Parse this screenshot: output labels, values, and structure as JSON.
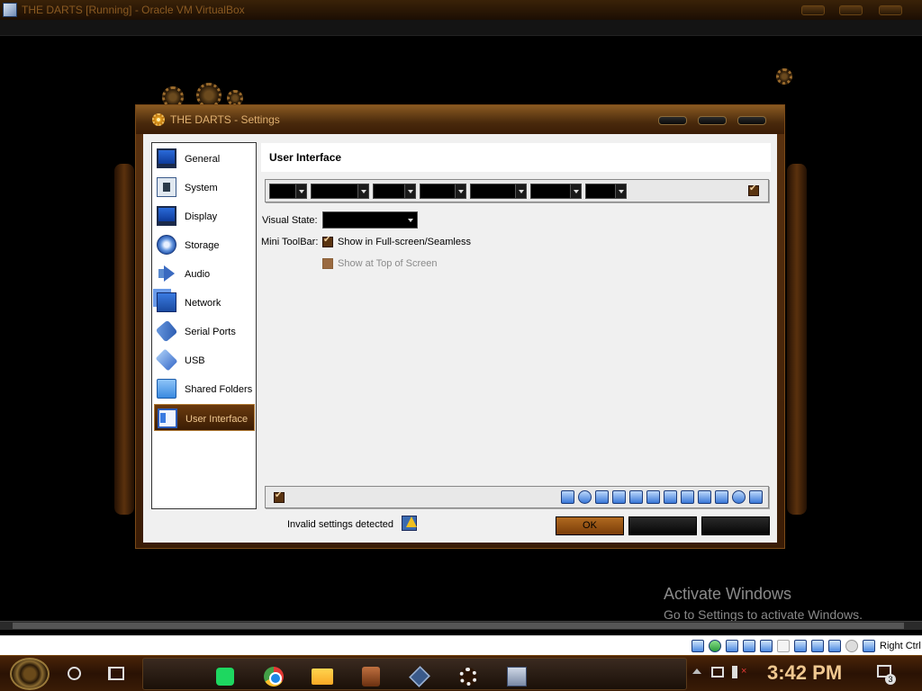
{
  "window": {
    "title": "THE DARTS [Running] - Oracle VM VirtualBox"
  },
  "dialog": {
    "title": "THE DARTS - Settings",
    "sidebar": [
      {
        "label": "General",
        "icon": "general-icon"
      },
      {
        "label": "System",
        "icon": "system-icon"
      },
      {
        "label": "Display",
        "icon": "display-icon"
      },
      {
        "label": "Storage",
        "icon": "storage-icon"
      },
      {
        "label": "Audio",
        "icon": "audio-icon"
      },
      {
        "label": "Network",
        "icon": "network-icon"
      },
      {
        "label": "Serial Ports",
        "icon": "serial-ports-icon"
      },
      {
        "label": "USB",
        "icon": "usb-icon"
      },
      {
        "label": "Shared Folders",
        "icon": "shared-folders-icon"
      },
      {
        "label": "User Interface",
        "icon": "user-interface-icon",
        "selected": true
      }
    ],
    "page_title": "User Interface",
    "visual_state_label": "Visual State:",
    "mini_toolbar_label": "Mini ToolBar:",
    "show_fullscreen_label": "Show in Full-screen/Seamless",
    "show_top_label": "Show at Top of Screen",
    "invalid_text": "Invalid settings detected",
    "ok_label": "OK",
    "menubar_enabled": true,
    "statusbar_enabled": true,
    "show_fullscreen_checked": true,
    "show_top_checked": false
  },
  "watermark": {
    "line1": "Activate Windows",
    "line2": "Go to Settings to activate Windows."
  },
  "vm_status": {
    "host_key": "Right Ctrl"
  },
  "taskbar": {
    "time": "3:42 PM",
    "notification_count": "3"
  },
  "colors": {
    "accent": "#7a3c08",
    "selection": "#3a1c04",
    "clock": "#f0c890"
  }
}
